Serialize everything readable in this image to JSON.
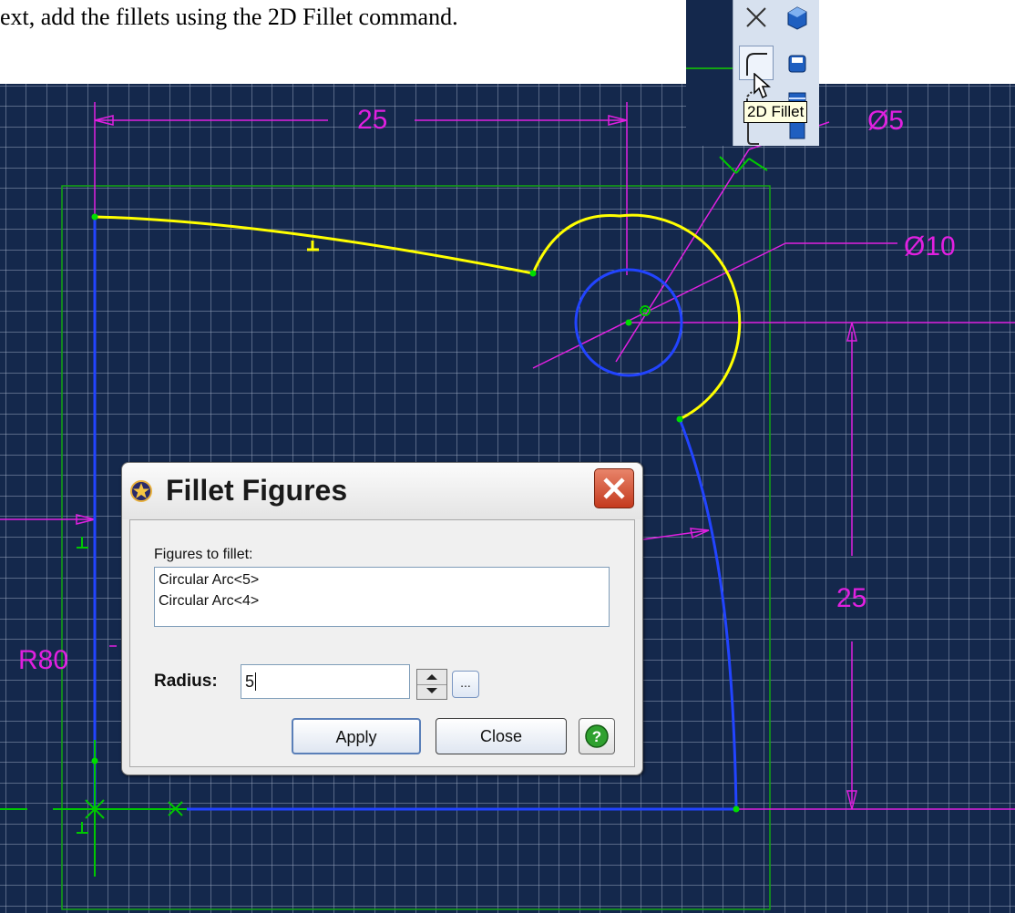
{
  "instruction": "ext, add the fillets using the 2D Fillet command.",
  "toolbar": {
    "tooltip": "2D Fillet",
    "buttons": [
      "trim-icon",
      "fillet-2d-icon",
      "chamfer-icon",
      "offset-icon",
      "solid-box-icon",
      "solid-shell-icon",
      "solid-view-icon",
      "solid-material-icon"
    ]
  },
  "dimensions": {
    "top_width": "25",
    "hole_diameter": "Ø5",
    "arc_diameter": "Ø10",
    "right_height": "25",
    "left_radius": "R80"
  },
  "dialog": {
    "title": "Fillet Figures",
    "figures_label": "Figures to fillet:",
    "figures": [
      "Circular Arc<5>",
      "Circular Arc<4>"
    ],
    "radius_label": "Radius:",
    "radius_value": "5",
    "browse_label": "...",
    "apply_label": "Apply",
    "close_label": "Close"
  },
  "colors": {
    "canvas": "#14284c",
    "grid": "#ffffff",
    "curve_selected": "#ffff00",
    "curve_profile": "#1a3cff",
    "dimension": "#e020e0",
    "constraint": "#00c800"
  }
}
